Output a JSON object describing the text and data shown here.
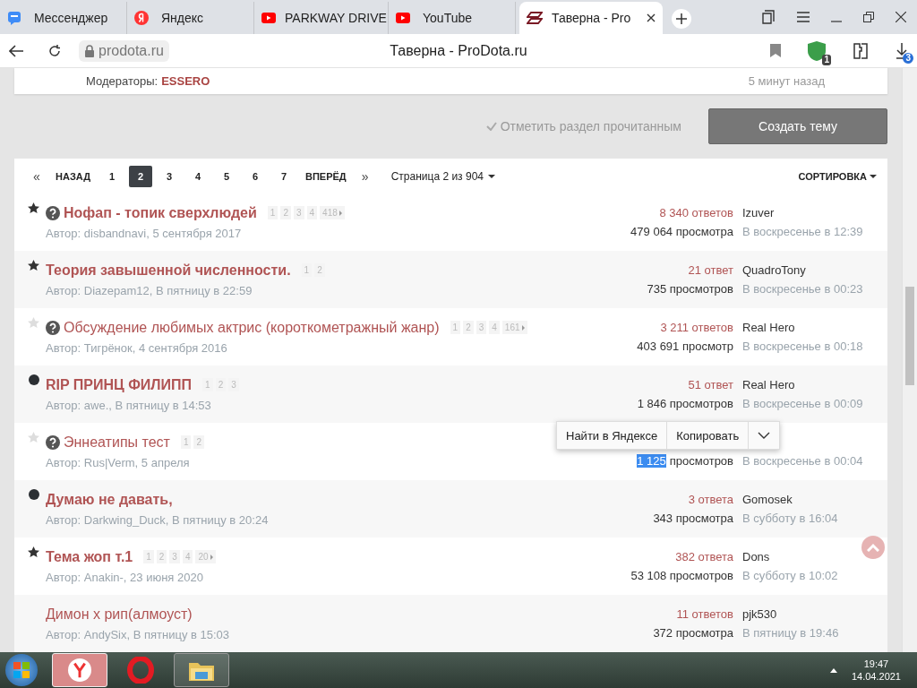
{
  "browser": {
    "tabs": [
      {
        "title": "Мессенджер",
        "kind": "messenger",
        "selected": false
      },
      {
        "title": "Яндекс",
        "kind": "yandex",
        "selected": false
      },
      {
        "title": "PARKWAY DRIVE",
        "kind": "youtube",
        "selected": false
      },
      {
        "title": "YouTube",
        "kind": "youtube",
        "selected": false
      },
      {
        "title": "Таверна - Pro",
        "kind": "prodota",
        "selected": true
      }
    ],
    "address": "prodota.ru",
    "page_title": "Таверна - ProDota.ru",
    "protect_badge": "1",
    "downloads_badge": "3"
  },
  "forum_header": {
    "moderators_label": "Модераторы:",
    "moderator": "ESSERO",
    "last_time": "5 минут назад"
  },
  "actions": {
    "mark_read": "Отметить раздел прочитанным",
    "create_topic": "Создать тему"
  },
  "pagination": {
    "first": "«",
    "prev": "НАЗАД",
    "pages": [
      {
        "label": "1",
        "selected": false
      },
      {
        "label": "2",
        "selected": true
      },
      {
        "label": "3",
        "selected": false
      },
      {
        "label": "4",
        "selected": false
      },
      {
        "label": "5",
        "selected": false
      },
      {
        "label": "6",
        "selected": false
      },
      {
        "label": "7",
        "selected": false
      }
    ],
    "next": "ВПЕРЁД",
    "last": "»",
    "page_info": "Страница 2 из 904",
    "sort": "СОРТИРОВКА"
  },
  "topics": [
    {
      "kind": "star",
      "question": true,
      "unread": true,
      "title": "Нофап - топик сверхлюдей",
      "pages": [
        "1",
        "2",
        "3",
        "4",
        "418"
      ],
      "author": "Автор: disbandnavi, 5 сентября 2017",
      "replies": "8 340 ответов",
      "views": "479 064 просмотра",
      "last_author": "Izuver",
      "last_time": "В воскресенье в 12:39"
    },
    {
      "kind": "star",
      "question": false,
      "unread": true,
      "title": "Теория завышенной численности.",
      "pages": [
        "1",
        "2"
      ],
      "author": "Автор: Diazepam12, В пятницу в 22:59",
      "replies": "21 ответ",
      "views": "735 просмотров",
      "last_author": "QuadroTony",
      "last_time": "В воскресенье в 00:23"
    },
    {
      "kind": "star-empty",
      "question": true,
      "unread": false,
      "title": "Обсуждение любимых актрис (короткометражный жанр)",
      "pages": [
        "1",
        "2",
        "3",
        "4",
        "161"
      ],
      "author": "Автор: Тигрёнок, 4 сентября 2016",
      "replies": "3 211 ответов",
      "views": "403 691 просмотр",
      "last_author": "Real Hero",
      "last_time": "В воскресенье в 00:18"
    },
    {
      "kind": "dot",
      "question": false,
      "unread": true,
      "title": "RIP ПРИНЦ ФИЛИПП",
      "pages": [
        "1",
        "2",
        "3"
      ],
      "author": "Автор: awe., В пятницу в 14:53",
      "replies": "51 ответ",
      "views": "1 846 просмотров",
      "last_author": "Real Hero",
      "last_time": "В воскресенье в 00:09"
    },
    {
      "kind": "star-empty",
      "question": true,
      "unread": false,
      "title": "Эннеатипы тест",
      "pages": [
        "1",
        "2"
      ],
      "author": "Автор: Rus|Verm, 5 апреля",
      "views_selected": "1 125",
      "views": "просмотров",
      "last_time": "В воскресенье в 00:04"
    },
    {
      "kind": "dot",
      "question": false,
      "unread": true,
      "title": "Думаю не давать,",
      "author": "Автор: Darkwing_Duck, В пятницу в 20:24",
      "replies": "3 ответа",
      "views": "343 просмотра",
      "last_author": "Gomosek",
      "last_time": "В субботу в 16:04"
    },
    {
      "kind": "star",
      "question": false,
      "unread": true,
      "title": "Тема жоп т.1",
      "pages": [
        "1",
        "2",
        "3",
        "4",
        "20"
      ],
      "author": "Автор: Anakin-, 23 июня 2020",
      "replies": "382 ответа",
      "views": "53 108 просмотров",
      "last_author": "Dons",
      "last_time": "В субботу в 10:02"
    },
    {
      "kind": "none",
      "question": false,
      "unread": false,
      "title": "Димон х рип(алмоуст)",
      "author": "Автор: AndySix, В пятницу в 15:03",
      "replies": "11 ответов",
      "views": "372 просмотра",
      "last_author": "pjk530",
      "last_time": "В пятницу в 19:46"
    }
  ],
  "context_menu": {
    "items": [
      "Найти в Яндексе",
      "Копировать"
    ]
  },
  "taskbar": {
    "apps": [
      {
        "kind": "yandex",
        "selected": true
      },
      {
        "kind": "opera",
        "selected": false
      },
      {
        "kind": "folder",
        "selected": false
      }
    ],
    "time": "19:47",
    "date": "14.04.2021"
  }
}
